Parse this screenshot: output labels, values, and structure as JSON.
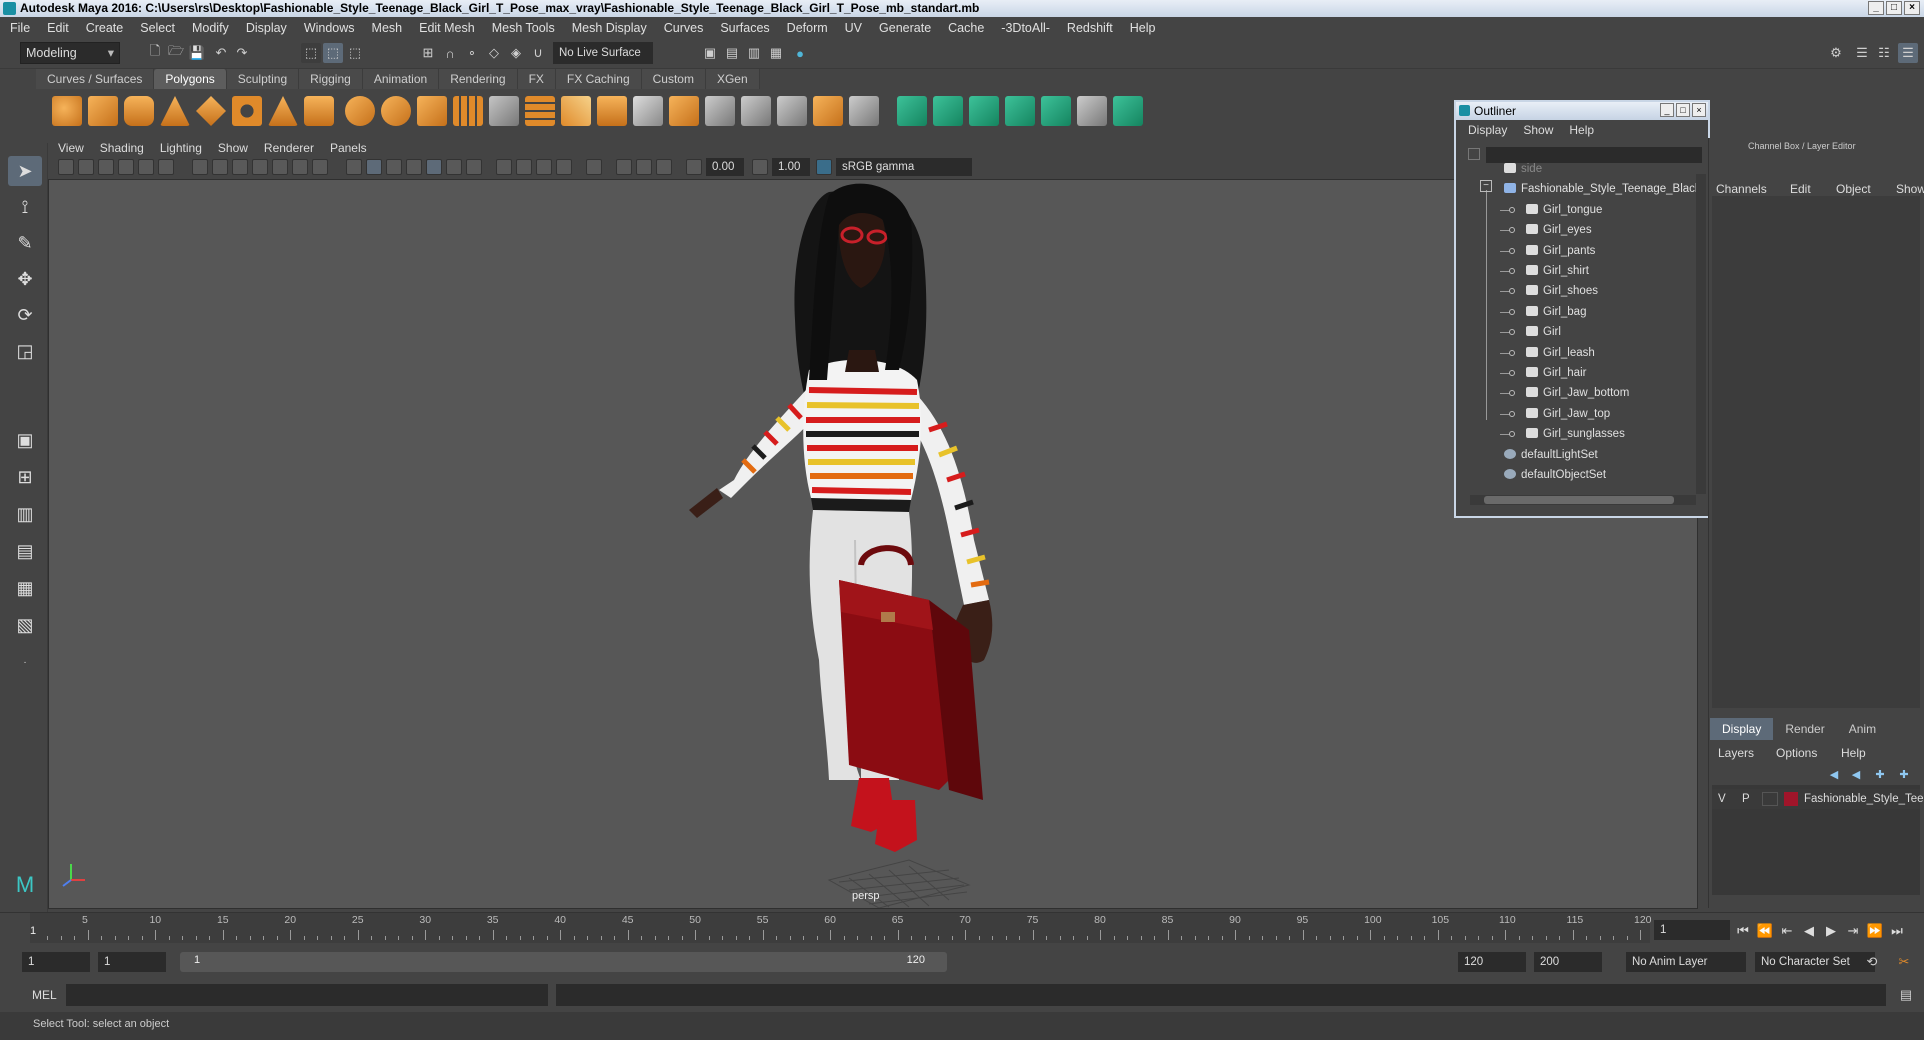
{
  "window": {
    "title": "Autodesk Maya 2016: C:\\Users\\rs\\Desktop\\Fashionable_Style_Teenage_Black_Girl_T_Pose_max_vray\\Fashionable_Style_Teenage_Black_Girl_T_Pose_mb_standart.mb"
  },
  "menubar": [
    "File",
    "Edit",
    "Create",
    "Select",
    "Modify",
    "Display",
    "Windows",
    "Mesh",
    "Edit Mesh",
    "Mesh Tools",
    "Mesh Display",
    "Curves",
    "Surfaces",
    "Deform",
    "UV",
    "Generate",
    "Cache",
    "-3DtoAll-",
    "Redshift",
    "Help"
  ],
  "status": {
    "mode": "Modeling",
    "live_surface": "No Live Surface"
  },
  "shelf": {
    "tabs": [
      "Curves / Surfaces",
      "Polygons",
      "Sculpting",
      "Rigging",
      "Animation",
      "Rendering",
      "FX",
      "FX Caching",
      "Custom",
      "XGen"
    ],
    "active_tab": "Polygons"
  },
  "panel": {
    "menu": [
      "View",
      "Shading",
      "Lighting",
      "Show",
      "Renderer",
      "Panels"
    ],
    "exposure": "0.00",
    "gamma": "1.00",
    "color_space": "sRGB gamma",
    "camera_label": "persp"
  },
  "outliner": {
    "title": "Outliner",
    "menu": [
      "Display",
      "Show",
      "Help"
    ],
    "items": [
      {
        "label": "side",
        "depth": 1
      },
      {
        "label": "Fashionable_Style_Teenage_Black",
        "depth": 1
      },
      {
        "label": "Girl_tongue",
        "depth": 2
      },
      {
        "label": "Girl_eyes",
        "depth": 2
      },
      {
        "label": "Girl_pants",
        "depth": 2
      },
      {
        "label": "Girl_shirt",
        "depth": 2
      },
      {
        "label": "Girl_shoes",
        "depth": 2
      },
      {
        "label": "Girl_bag",
        "depth": 2
      },
      {
        "label": "Girl",
        "depth": 2
      },
      {
        "label": "Girl_leash",
        "depth": 2
      },
      {
        "label": "Girl_hair",
        "depth": 2
      },
      {
        "label": "Girl_Jaw_bottom",
        "depth": 2
      },
      {
        "label": "Girl_Jaw_top",
        "depth": 2
      },
      {
        "label": "Girl_sunglasses",
        "depth": 2
      },
      {
        "label": "defaultLightSet",
        "depth": 1
      },
      {
        "label": "defaultObjectSet",
        "depth": 1
      }
    ]
  },
  "channel_box": {
    "title": "Channel Box / Layer Editor",
    "menu": [
      "Channels",
      "Edit",
      "Object",
      "Show"
    ]
  },
  "layer_editor": {
    "tabs": [
      "Display",
      "Render",
      "Anim"
    ],
    "active_tab": "Display",
    "menu": [
      "Layers",
      "Options",
      "Help"
    ],
    "layer": {
      "v": "V",
      "p": "P",
      "name": "Fashionable_Style_Tee",
      "color": "#a0152a"
    }
  },
  "timeline": {
    "ticks": [
      "5",
      "10",
      "15",
      "20",
      "25",
      "30",
      "35",
      "40",
      "45",
      "50",
      "55",
      "60",
      "65",
      "70",
      "75",
      "80",
      "85",
      "90",
      "95",
      "100",
      "105",
      "110",
      "115",
      "120"
    ],
    "current_frame": "1",
    "start_mark": "1"
  },
  "range": {
    "start": "1",
    "inner_start": "1",
    "slider_start": "1",
    "slider_end": "120",
    "end": "120",
    "max": "200",
    "anim_layer": "No Anim Layer",
    "character_set": "No Character Set"
  },
  "command": {
    "lang": "MEL"
  },
  "help_line": "Select Tool: select an object",
  "colors": {
    "accent": "#5d6a78",
    "viewport_bg": "#575757"
  }
}
